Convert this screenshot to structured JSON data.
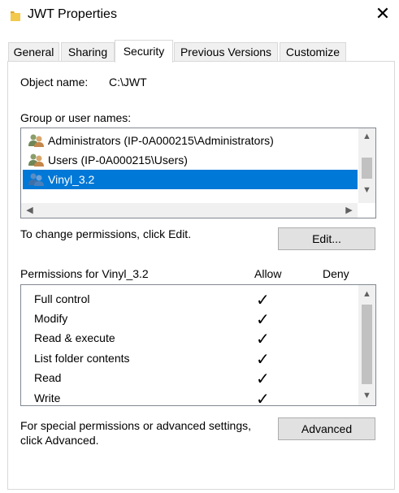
{
  "window": {
    "title": "JWT Properties",
    "close_glyph": "✕"
  },
  "tabs": [
    {
      "label": "General",
      "active": false
    },
    {
      "label": "Sharing",
      "active": false
    },
    {
      "label": "Security",
      "active": true
    },
    {
      "label": "Previous Versions",
      "active": false
    },
    {
      "label": "Customize",
      "active": false
    }
  ],
  "object": {
    "label": "Object name:",
    "value": "C:\\JWT"
  },
  "group": {
    "label": "Group or user names:",
    "users": [
      {
        "name": "Administrators (IP-0A000215\\Administrators)",
        "selected": false
      },
      {
        "name": "Users (IP-0A000215\\Users)",
        "selected": false
      },
      {
        "name": "Vinyl_3.2",
        "selected": true
      }
    ]
  },
  "change": {
    "text": "To change permissions, click Edit.",
    "edit_label": "Edit..."
  },
  "permissions": {
    "header": "Permissions for Vinyl_3.2",
    "allow_label": "Allow",
    "deny_label": "Deny",
    "rows": [
      {
        "name": "Full control",
        "allow": "✓",
        "deny": ""
      },
      {
        "name": "Modify",
        "allow": "✓",
        "deny": ""
      },
      {
        "name": "Read & execute",
        "allow": "✓",
        "deny": ""
      },
      {
        "name": "List folder contents",
        "allow": "✓",
        "deny": ""
      },
      {
        "name": "Read",
        "allow": "✓",
        "deny": ""
      },
      {
        "name": "Write",
        "allow": "✓",
        "deny": ""
      }
    ]
  },
  "special": {
    "line1": "For special permissions or advanced settings,",
    "line2": "click Advanced.",
    "advanced_label": "Advanced"
  },
  "colors": {
    "selection": "#0078d7",
    "folder": "#f2c94c"
  },
  "icons": {
    "title": "folder-icon",
    "user": "users-group-icon",
    "check": "check-icon"
  }
}
